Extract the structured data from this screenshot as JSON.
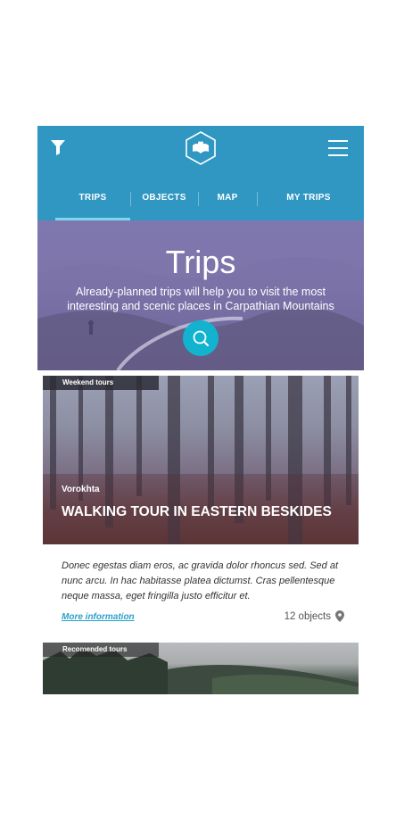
{
  "header": {
    "filter_icon": "filter-icon",
    "logo_icon": "book-heart-logo",
    "menu_icon": "hamburger-icon",
    "accent": "#2f97c1",
    "active_tab_indicator": "#7fd6f1"
  },
  "tabs": [
    {
      "label": "TRIPS",
      "active": true
    },
    {
      "label": "OBJECTS",
      "active": false
    },
    {
      "label": "MAP",
      "active": false
    },
    {
      "label": "MY TRIPS",
      "active": false
    }
  ],
  "hero": {
    "title": "Trips",
    "subtitle": "Already-planned trips will help you to visit the most interesting and scenic places in Carpathian Mountains",
    "search_icon": "search-icon",
    "search_color": "#12b3cf"
  },
  "cards": [
    {
      "badge": "Weekend tours",
      "location": "Vorokhta",
      "title": "WALKING TOUR IN EASTERN BESKIDES",
      "description": "Donec egestas diam eros, ac gravida dolor rhoncus sed. Sed at nunc arcu. In hac habitasse platea dictumst. Cras pellentesque neque massa, eget fringilla justo efficitur et.",
      "link": "More information",
      "objects": "12 objects",
      "objects_icon": "map-pin-icon"
    },
    {
      "badge": "Recomended tours"
    }
  ]
}
